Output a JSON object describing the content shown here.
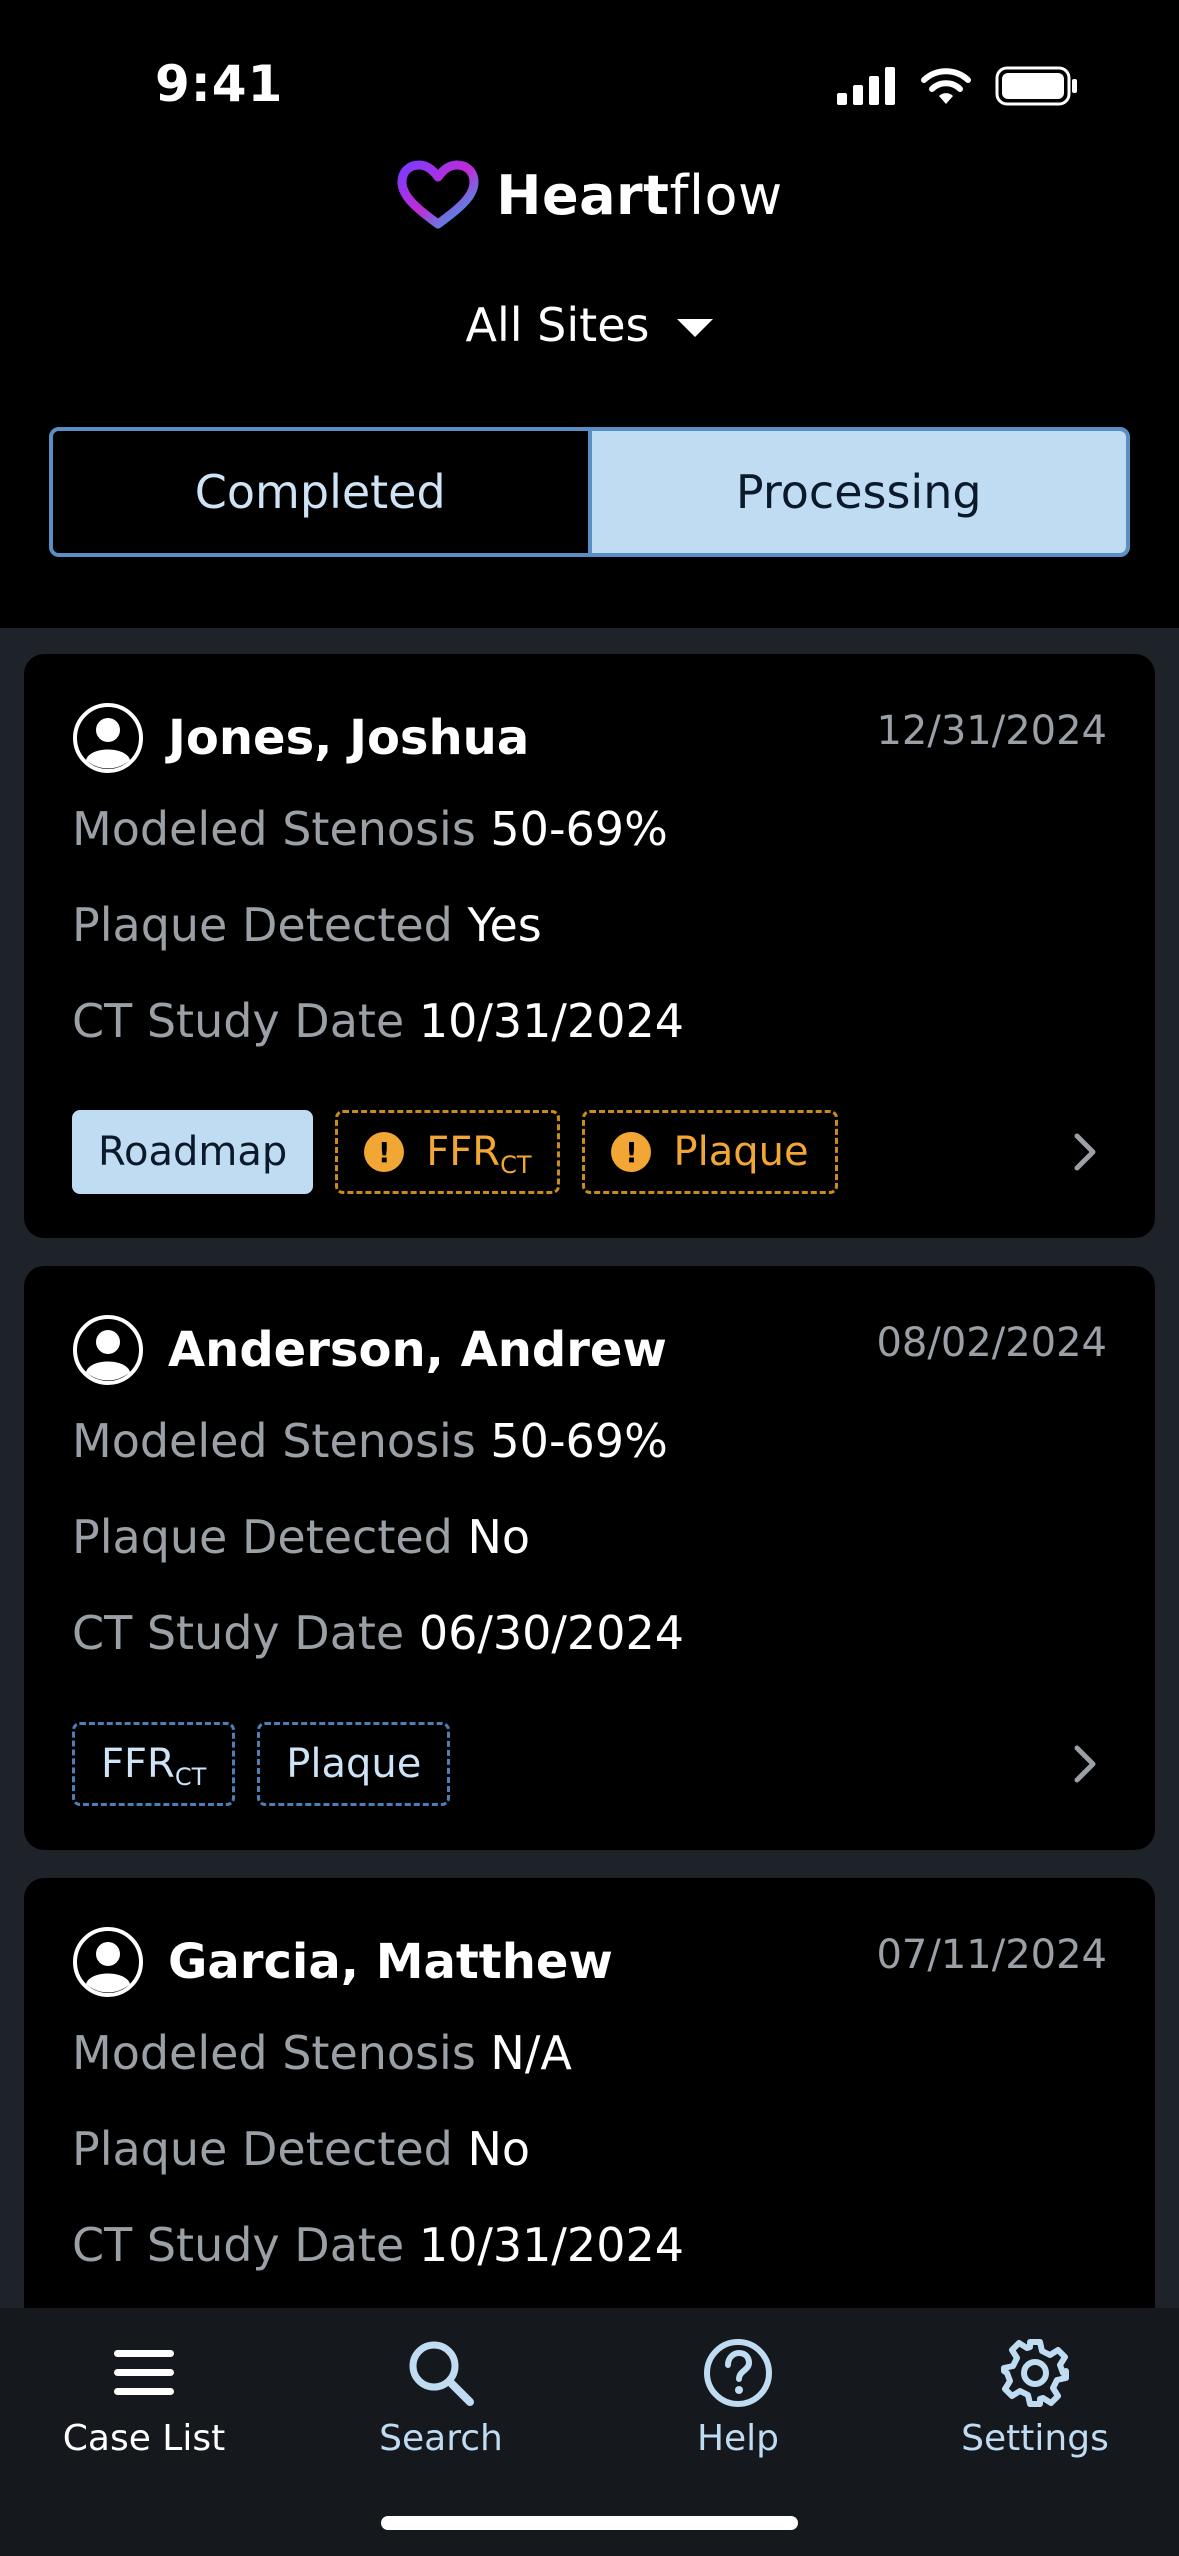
{
  "status_bar": {
    "time": "9:41"
  },
  "header": {
    "brand_bold": "Heart",
    "brand_rest": "flow",
    "site_selector": "All Sites"
  },
  "segments": [
    {
      "label": "Completed",
      "selected": false
    },
    {
      "label": "Processing",
      "selected": true
    }
  ],
  "cases": [
    {
      "name": "Jones, Joshua",
      "date": "12/31/2024",
      "stenosis_label": "Modeled Stenosis",
      "stenosis_value": "50-69%",
      "plaque_label": "Plaque Detected",
      "plaque_value": "Yes",
      "ct_label": "CT Study Date",
      "ct_value": "10/31/2024",
      "chips": {
        "roadmap": "Roadmap",
        "ffr_main": "FFR",
        "ffr_sub": "CT",
        "plaque": "Plaque"
      }
    },
    {
      "name": "Anderson, Andrew",
      "date": "08/02/2024",
      "stenosis_label": "Modeled Stenosis",
      "stenosis_value": "50-69%",
      "plaque_label": "Plaque Detected",
      "plaque_value": "No",
      "ct_label": "CT Study Date",
      "ct_value": "06/30/2024",
      "chips": {
        "ffr_main": "FFR",
        "ffr_sub": "CT",
        "plaque": "Plaque"
      }
    },
    {
      "name": "Garcia, Matthew",
      "date": "07/11/2024",
      "stenosis_label": "Modeled Stenosis",
      "stenosis_value": "N/A",
      "plaque_label": "Plaque Detected",
      "plaque_value": "No",
      "ct_label": "CT Study Date",
      "ct_value": "10/31/2024"
    }
  ],
  "tabbar": [
    {
      "label": "Case List",
      "icon": "list-icon"
    },
    {
      "label": "Search",
      "icon": "search-icon"
    },
    {
      "label": "Help",
      "icon": "help-icon"
    },
    {
      "label": "Settings",
      "icon": "gear-icon"
    }
  ],
  "colors": {
    "accent_light_blue": "#bfdcf3",
    "outline_blue": "#5b8fc4",
    "warning_orange": "#f2a633",
    "muted_text": "#9aa0a6"
  }
}
